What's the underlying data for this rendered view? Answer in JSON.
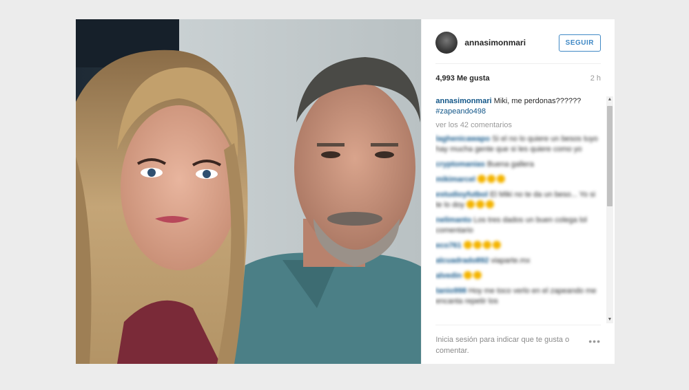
{
  "post": {
    "username": "annasimonmari",
    "follow_label": "SEGUIR",
    "likes": "4,993 Me gusta",
    "time": "2 h",
    "caption_user": "annasimonmari",
    "caption_text": " Miki, me perdonas?????? ",
    "caption_tag": "#zapeando498",
    "view_comments": "ver los 42 comentarios"
  },
  "comments": [
    {
      "user": "laghenicawapo",
      "text": " Si el no lo quiere un besos tuyo hay mucha gente que si les quiere como yo"
    },
    {
      "user": "cryptomanias",
      "text": " Buena gallera"
    },
    {
      "user": "mikimarcel",
      "text": " "
    },
    {
      "user": "estudioyfutbol",
      "text": " El Miki no te da un beso... Yo si te lo doy"
    },
    {
      "user": "nelimanto",
      "text": " Los tres dados un buen colega lol comentario"
    },
    {
      "user": "eco761",
      "text": " "
    },
    {
      "user": "alcuadrado892",
      "text": " viaparte.mx"
    },
    {
      "user": "alvedin",
      "text": " "
    },
    {
      "user": "tanio998",
      "text": " Hoy me toco verlo en el zapeando me encanta repetir los"
    }
  ],
  "footer": {
    "login_prompt": "Inicia sesión para indicar que te gusta o comentar.",
    "more_icon": "•••"
  },
  "colors": {
    "link": "#125688",
    "follow": "#3f88c5",
    "muted": "#999999"
  }
}
